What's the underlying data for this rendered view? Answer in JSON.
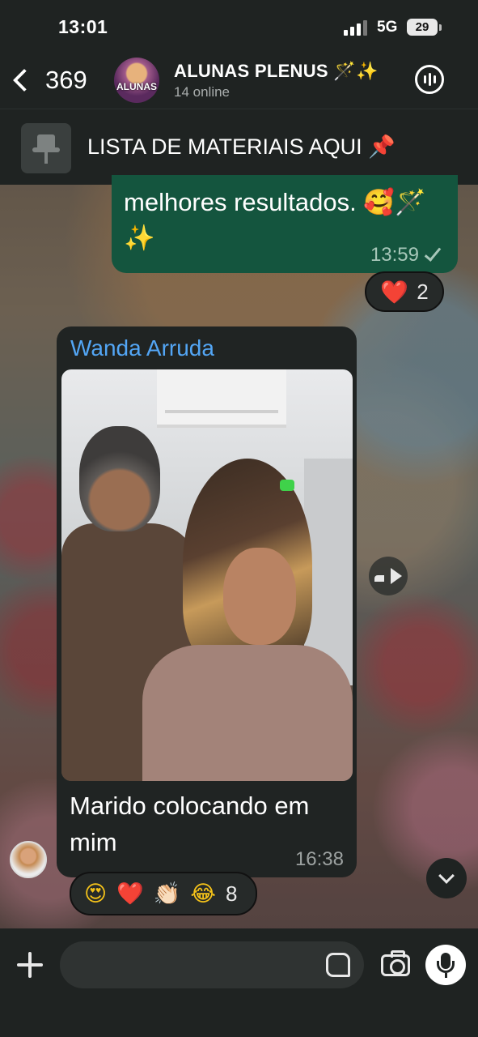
{
  "status_bar": {
    "time": "13:01",
    "network": "5G",
    "battery": "29"
  },
  "header": {
    "back_count": "369",
    "avatar_text": "ALUNAS",
    "group_name": "ALUNAS PLENUS 🪄✨",
    "online": "14 online"
  },
  "pinned": {
    "text": "LISTA DE MATERIAIS AQUI 📌"
  },
  "messages": {
    "outgoing": {
      "text": "melhores resultados. 🥰🪄✨",
      "time": "13:59"
    },
    "outgoing_reaction": {
      "emoji": "❤️",
      "count": "2"
    },
    "incoming": {
      "sender": "Wanda Arruda",
      "caption": "Marido colocando em mim",
      "time": "16:38"
    },
    "incoming_reactions": {
      "emojis": [
        "😍",
        "❤️",
        "👏🏻",
        "😂"
      ],
      "count": "8"
    }
  },
  "input": {
    "placeholder": ""
  },
  "colors": {
    "outgoing_bubble": "#14553e",
    "incoming_bubble": "#202423",
    "sender_name": "#53a6f5",
    "bars": "#1f2322"
  }
}
